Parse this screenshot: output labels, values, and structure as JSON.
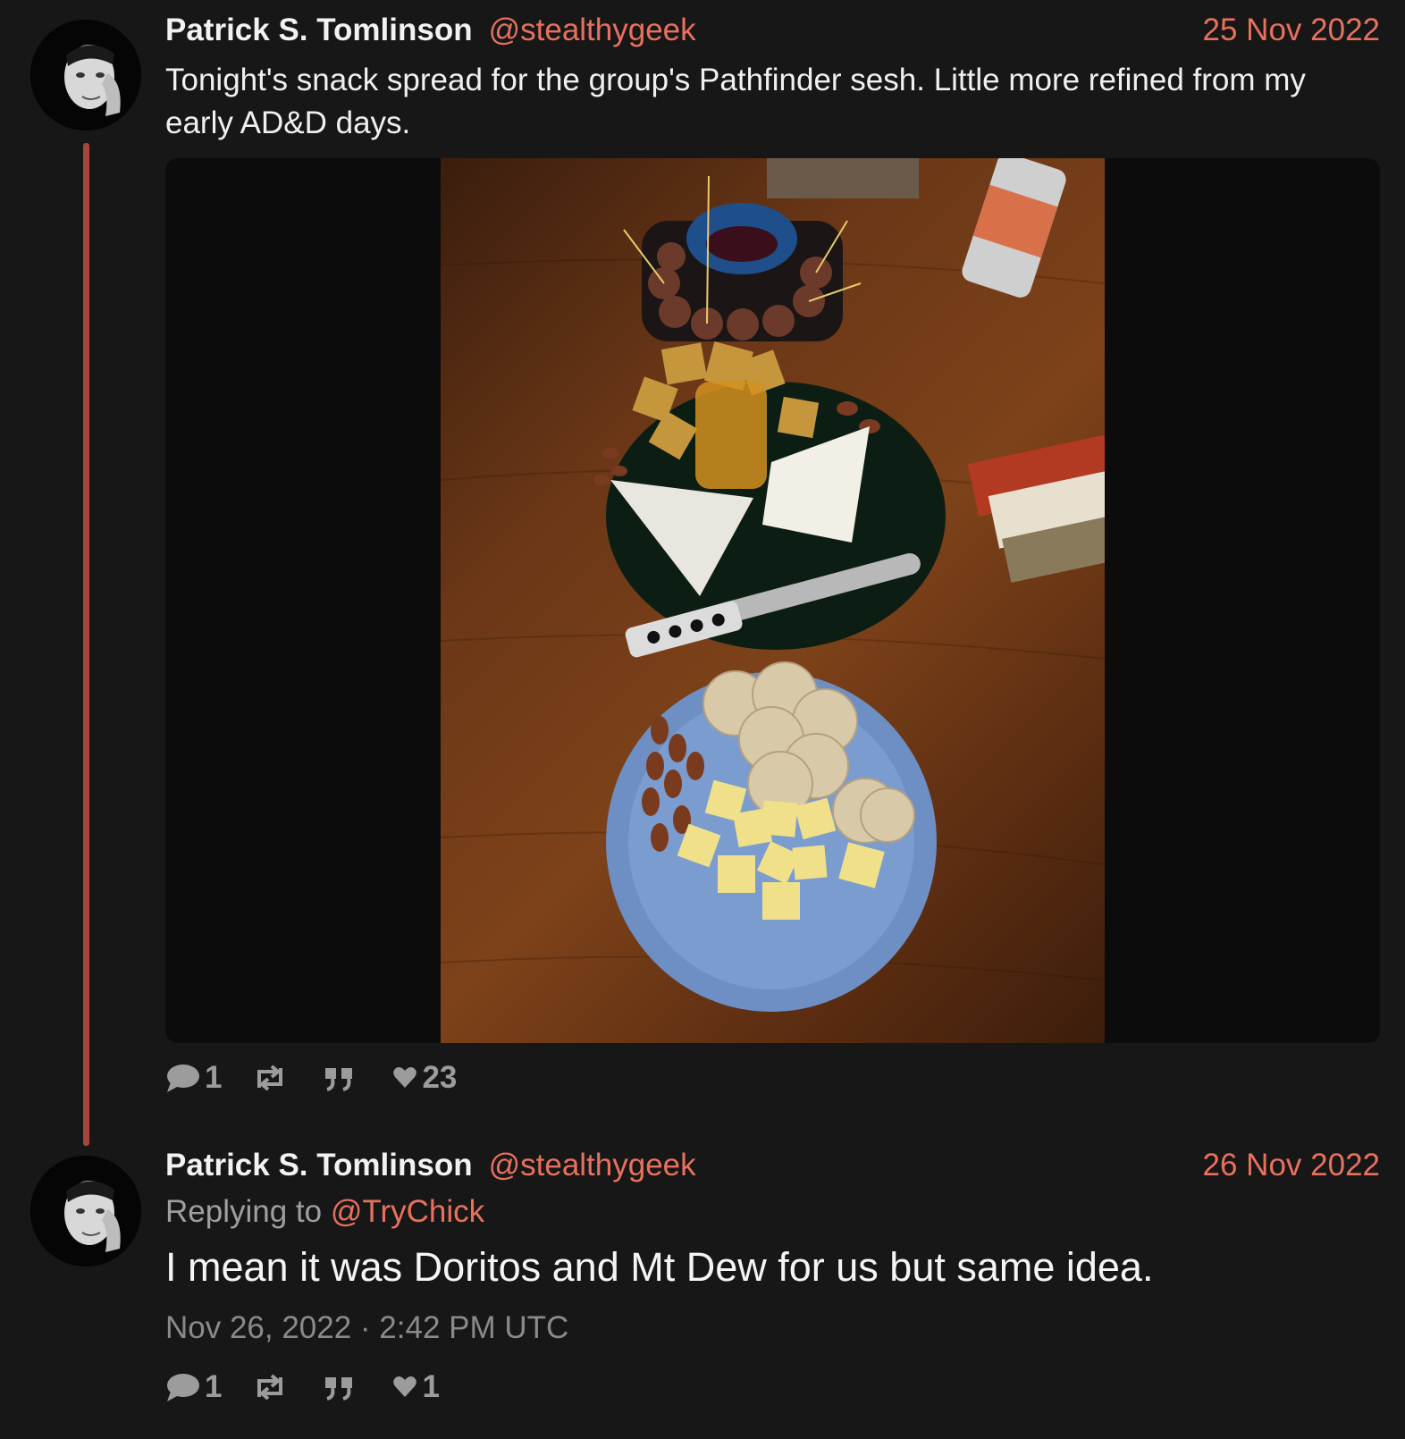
{
  "tweets": [
    {
      "fullname": "Patrick S. Tomlinson",
      "username": "@stealthygeek",
      "date": "25 Nov 2022",
      "text": "Tonight's snack spread for the group's Pathfinder sesh. Little more refined from my early AD&D days.",
      "stats": {
        "comments": "1",
        "retweets": "",
        "quotes": "",
        "likes": "23"
      }
    },
    {
      "fullname": "Patrick S. Tomlinson",
      "username": "@stealthygeek",
      "date": "26 Nov 2022",
      "replying_label": "Replying to",
      "replying_to": "@TryChick",
      "text": "I mean it was Doritos and Mt Dew for us but same idea.",
      "timestamp": "Nov 26, 2022 · 2:42 PM UTC",
      "stats": {
        "comments": "1",
        "retweets": "",
        "quotes": "",
        "likes": "1"
      }
    }
  ],
  "icons": {
    "comment": "comment-icon",
    "retweet": "retweet-icon",
    "quote": "quote-icon",
    "like": "heart-icon"
  },
  "colors": {
    "background": "#171717",
    "accent": "#e8715e",
    "thread_line": "#a5463c",
    "muted": "#9c9c9c"
  }
}
